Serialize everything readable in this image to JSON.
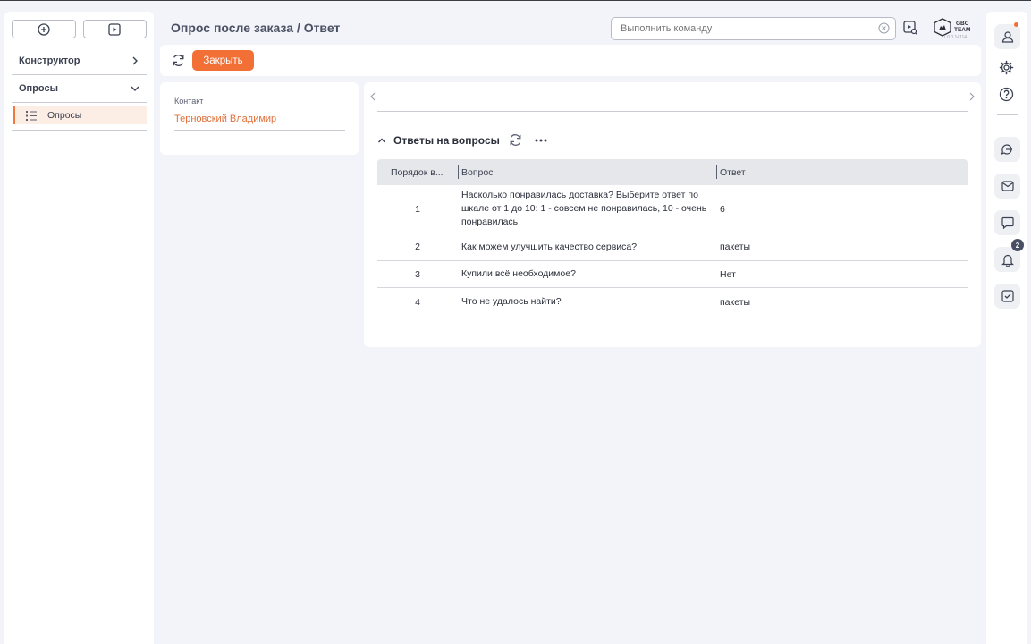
{
  "header": {
    "title": "Опрос после заказа / Ответ",
    "command_placeholder": "Выполнить команду",
    "logo_line1": "GBC",
    "logo_line2": "TEAM",
    "version": "1.0.0.14114"
  },
  "sidebar": {
    "sections": [
      {
        "label": "Конструктор"
      },
      {
        "label": "Опросы"
      }
    ],
    "active_item": "Опросы"
  },
  "toolbar": {
    "close_label": "Закрыть"
  },
  "contact": {
    "label": "Контакт",
    "value": "Терновский Владимир"
  },
  "answers": {
    "title": "Ответы на вопросы",
    "columns": [
      "Порядок в...",
      "Вопрос",
      "Ответ"
    ],
    "rows": [
      {
        "order": "1",
        "question": "Насколько понравилась доставка? Выберите ответ по шкале от 1 до 10: 1 - совсем не понравилась, 10 - очень понравилась",
        "answer": "6"
      },
      {
        "order": "2",
        "question": "Как можем улучшить качество сервиса?",
        "answer": "пакеты"
      },
      {
        "order": "3",
        "question": "Купили всё необходимое?",
        "answer": "Нет"
      },
      {
        "order": "4",
        "question": "Что не удалось найти?",
        "answer": "пакеты"
      }
    ]
  },
  "rail": {
    "notifications_count": "2"
  },
  "colors": {
    "accent": "#f26f36",
    "background": "#f3f4f9",
    "header_row": "#e6e7ea"
  }
}
